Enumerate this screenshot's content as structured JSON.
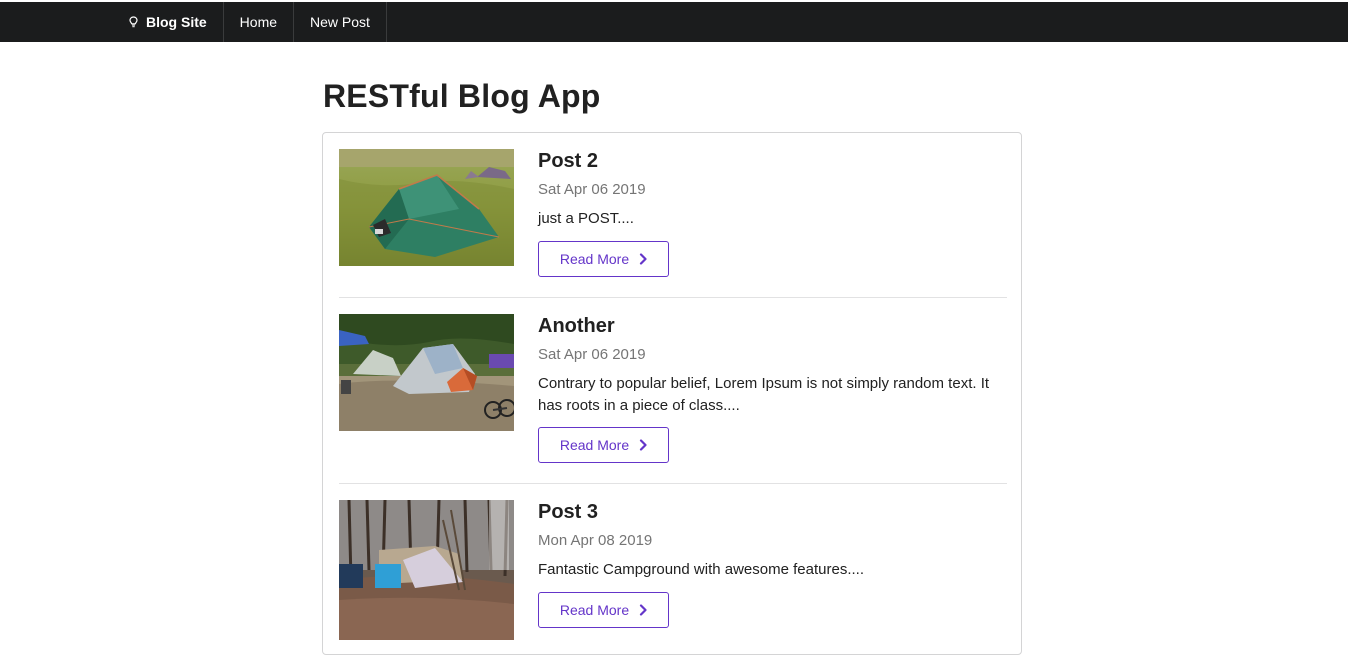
{
  "navbar": {
    "brand": "Blog Site",
    "brand_icon": "lightbulb-icon",
    "items": [
      {
        "label": "Home"
      },
      {
        "label": "New Post"
      }
    ]
  },
  "page": {
    "title": "RESTful Blog App"
  },
  "posts": [
    {
      "title": "Post 2",
      "date": "Sat Apr 06 2019",
      "excerpt": "just a POST....",
      "image": "tent-on-grass-photo",
      "button": "Read More",
      "button_icon": "chevron-right-icon"
    },
    {
      "title": "Another",
      "date": "Sat Apr 06 2019",
      "excerpt": "Contrary to popular belief, Lorem Ipsum is not simply random text. It has roots in a piece of class....",
      "image": "campsite-tents-photo",
      "button": "Read More",
      "button_icon": "chevron-right-icon"
    },
    {
      "title": "Post 3",
      "date": "Mon Apr 08 2019",
      "excerpt": "Fantastic Campground with awesome features....",
      "image": "forest-campground-photo",
      "button": "Read More",
      "button_icon": "chevron-right-icon"
    }
  ],
  "colors": {
    "navbar_bg": "#1b1c1d",
    "accent": "#6435c9",
    "text": "#212121",
    "muted": "#757575"
  }
}
